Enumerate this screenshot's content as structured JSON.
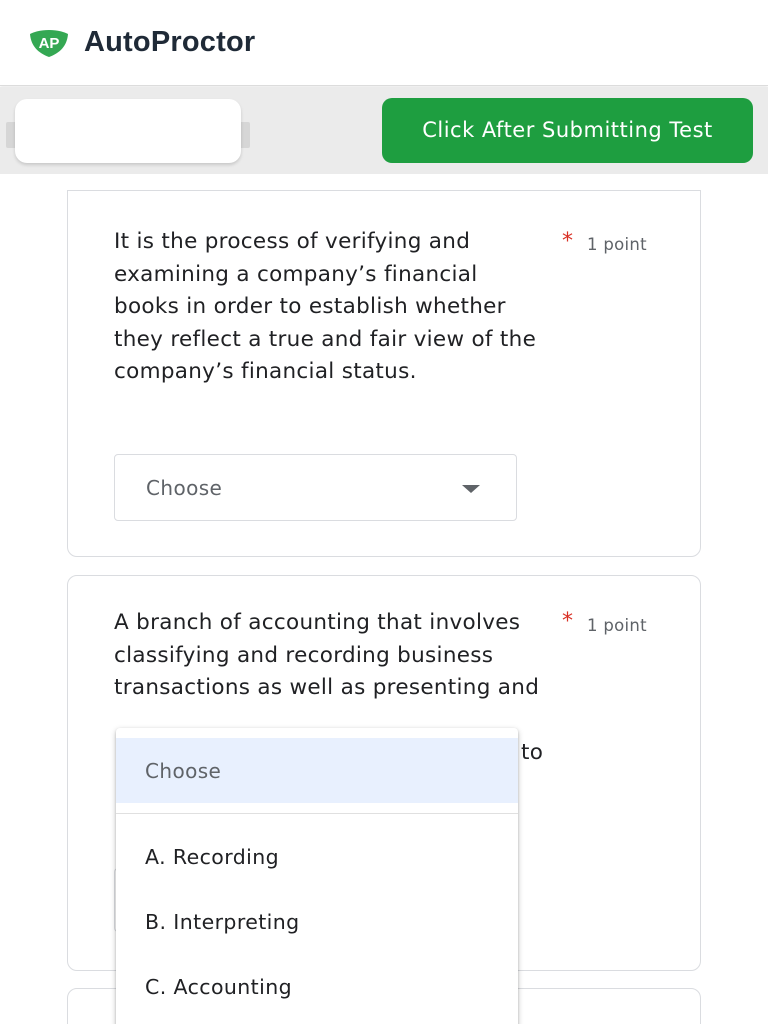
{
  "header": {
    "brand": "AutoProctor",
    "logo_icon": "autoproctor-shield-logo",
    "logo_color": "#34a853"
  },
  "toolbar": {
    "submit_label": "Click After Submitting Test",
    "submit_color": "#1e9e40"
  },
  "questions": [
    {
      "text": "It is the process of verifying and examining a company’s financial books in order to establish whether they reflect a true and fair view of the company’s financial status.",
      "required_mark": "*",
      "points": "1 point",
      "select_value": "Choose"
    },
    {
      "text": "A branch of accounting that involves classifying and recording business transactions as well as presenting and",
      "tail_text": "to",
      "required_mark": "*",
      "points": "1 point"
    }
  ],
  "dropdown": {
    "selected": "Choose",
    "options": [
      "A. Recording",
      "B. Interpreting",
      "C. Accounting"
    ],
    "highlight_color": "#e8f0fe"
  }
}
